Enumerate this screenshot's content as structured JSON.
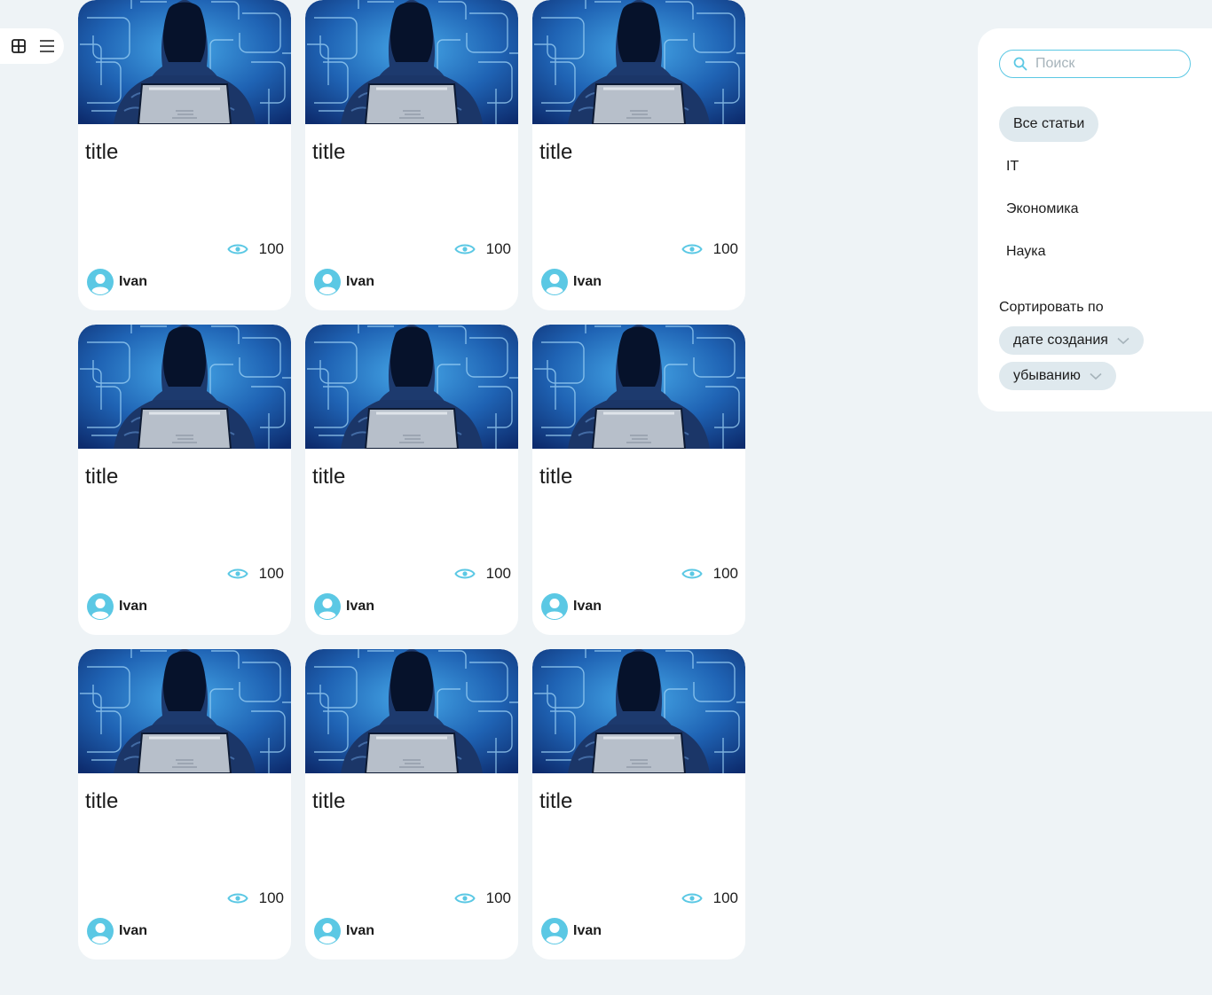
{
  "view_switcher": {
    "grid_icon": "grid-icon",
    "list_icon": "list-icon"
  },
  "articles": [
    {
      "title": "title",
      "views": "100",
      "author": "Ivan"
    },
    {
      "title": "title",
      "views": "100",
      "author": "Ivan"
    },
    {
      "title": "title",
      "views": "100",
      "author": "Ivan"
    },
    {
      "title": "title",
      "views": "100",
      "author": "Ivan"
    },
    {
      "title": "title",
      "views": "100",
      "author": "Ivan"
    },
    {
      "title": "title",
      "views": "100",
      "author": "Ivan"
    },
    {
      "title": "title",
      "views": "100",
      "author": "Ivan"
    },
    {
      "title": "title",
      "views": "100",
      "author": "Ivan"
    },
    {
      "title": "title",
      "views": "100",
      "author": "Ivan"
    }
  ],
  "sidebar": {
    "search": {
      "placeholder": "Поиск",
      "value": ""
    },
    "categories": [
      {
        "label": "Все статьи",
        "active": true
      },
      {
        "label": "IT",
        "active": false
      },
      {
        "label": "Экономика",
        "active": false
      },
      {
        "label": "Наука",
        "active": false
      }
    ],
    "sort_label": "Сортировать по",
    "sort_field": "дате создания",
    "sort_order": "убыванию"
  },
  "colors": {
    "background": "#eef3f6",
    "accent": "#5bc8e4",
    "pill": "#dfe9ee"
  }
}
